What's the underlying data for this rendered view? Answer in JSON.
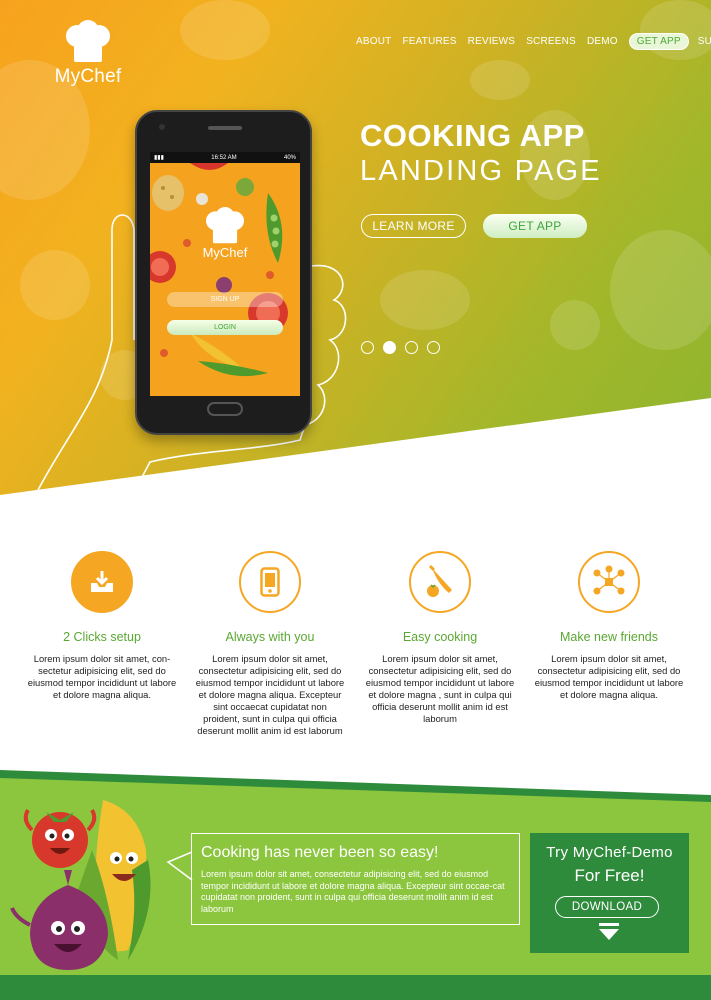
{
  "brand": {
    "name": "MyChef"
  },
  "nav": {
    "items": [
      "ABOUT",
      "FEATURES",
      "REVIEWS",
      "SCREENS",
      "DEMO",
      "GET APP",
      "SUPPORT"
    ],
    "highlighted": "GET APP"
  },
  "hero": {
    "title": "COOKING APP",
    "subtitle": "LANDING PAGE",
    "learn_more_label": "LEARN MORE",
    "get_app_label": "GET APP",
    "slides": {
      "count": 4,
      "active_index": 1
    }
  },
  "phone": {
    "time": "16:52 AM",
    "battery": "40%",
    "logo_text": "MyChef",
    "signup_label": "SIGN UP",
    "login_label": "LOGIN"
  },
  "features": [
    {
      "icon": "download-tray-icon",
      "title": "2 Clicks setup",
      "text": "Lorem ipsum dolor sit amet, con-sectetur adipisicing elit, sed do eiusmod tempor incididunt ut labore et dolore magna aliqua."
    },
    {
      "icon": "smartphone-icon",
      "title": "Always with you",
      "text": "Lorem ipsum dolor sit amet, consectetur adipisicing elit, sed do eiusmod tempor incididunt ut labore et dolore magna aliqua. Excepteur sint occaecat cupidatat non proident, sunt in culpa qui officia deserunt mollit anim id est laborum"
    },
    {
      "icon": "knife-tomato-icon",
      "title": "Easy cooking",
      "text": "Lorem ipsum dolor sit amet, consectetur adipisicing elit, sed do eiusmod tempor incididunt ut labore et dolore magna , sunt in culpa qui officia deserunt mollit anim id est laborum"
    },
    {
      "icon": "friends-network-icon",
      "title": "Make new friends",
      "text": "Lorem ipsum dolor sit amet, consectetur adipisicing elit, sed do eiusmod tempor incididunt ut labore et dolore magna aliqua."
    }
  ],
  "promo": {
    "title": "Cooking has never been so easy!",
    "text": "Lorem ipsum dolor sit amet, consectetur adipisicing elit, sed do eiusmod tempor incididunt ut labore et dolore magna aliqua. Excepteur sint occae-cat cupidatat non proident, sunt in culpa qui officia deserunt mollit anim id est laborum"
  },
  "demo": {
    "line1": "Try MyChef-Demo",
    "line2": "For Free!",
    "download_label": "DOWNLOAD"
  },
  "colors": {
    "accent_orange": "#f5a623",
    "accent_green": "#5aa832",
    "dark_green": "#2f8b3c",
    "bottom_green": "#8cc63f"
  }
}
